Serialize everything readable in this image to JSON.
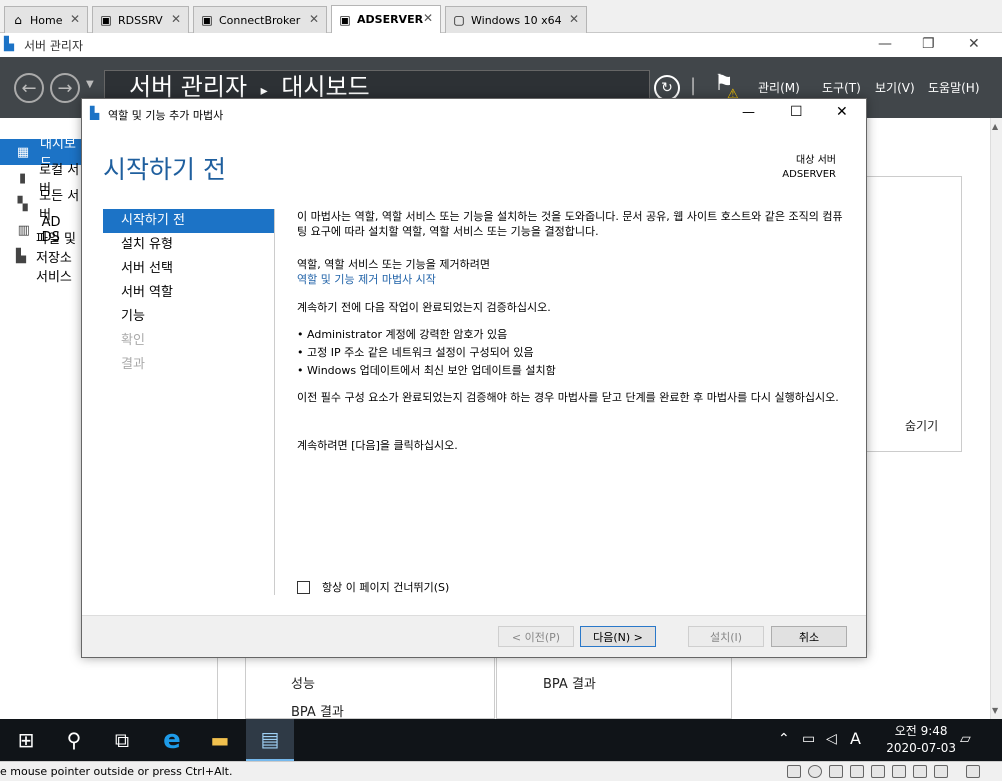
{
  "host_tabs": [
    {
      "label": "Home",
      "icon": "home-icon"
    },
    {
      "label": "RDSSRV",
      "icon": "vm-icon"
    },
    {
      "label": "ConnectBroker",
      "icon": "vm-icon"
    },
    {
      "label": "ADSERVER",
      "icon": "vm-icon"
    },
    {
      "label": "Windows 10 x64",
      "icon": "vm-icon"
    }
  ],
  "server_manager": {
    "window_title": "서버 관리자",
    "breadcrumb": {
      "root": "서버 관리자",
      "separator": "▸",
      "page": "대시보드"
    },
    "menu": [
      "관리(M)",
      "도구(T)",
      "보기(V)",
      "도움말(H)"
    ],
    "sidebar": [
      "대시보드",
      "로컬 서버",
      "모든 서버",
      "AD DS",
      "파일 및 저장소 서비스"
    ],
    "background": {
      "hide_label": "숨기기",
      "tile1": [
        "성능",
        "BPA 결과"
      ],
      "tile2": [
        "BPA 결과"
      ]
    }
  },
  "wizard": {
    "title": "역할 및 기능 추가 마법사",
    "heading": "시작하기 전",
    "dest_label": "대상 서버",
    "dest_server": "ADSERVER",
    "steps": [
      {
        "label": "시작하기 전",
        "state": "active"
      },
      {
        "label": "설치 유형",
        "state": "enabled"
      },
      {
        "label": "서버 선택",
        "state": "enabled"
      },
      {
        "label": "서버 역할",
        "state": "enabled"
      },
      {
        "label": "기능",
        "state": "enabled"
      },
      {
        "label": "확인",
        "state": "disabled"
      },
      {
        "label": "결과",
        "state": "disabled"
      }
    ],
    "intro": "이 마법사는 역할, 역할 서비스 또는 기능을 설치하는 것을 도와줍니다. 문서 공유, 웹 사이트 호스트와 같은 조직의 컴퓨팅 요구에 따라 설치할 역할, 역할 서비스 또는 기능을 결정합니다.",
    "remove_text": "역할, 역할 서비스 또는 기능을 제거하려면",
    "remove_link": "역할 및 기능 제거 마법사 시작",
    "verify_text": "계속하기 전에 다음 작업이 완료되었는지 검증하십시오.",
    "bullets": [
      "Administrator 계정에 강력한 암호가 있음",
      "고정 IP 주소 같은 네트워크 설정이 구성되어 있음",
      "Windows 업데이트에서 최신 보안 업데이트를 설치함"
    ],
    "prereq_text": "이전 필수 구성 요소가 완료되었는지 검증해야 하는 경우 마법사를 닫고 단계를 완료한 후 마법사를 다시 실행하십시오.",
    "continue_text": "계속하려면 [다음]을 클릭하십시오.",
    "skip_checkbox": "항상 이 페이지 건너뛰기(S)",
    "buttons": {
      "prev": "< 이전(P)",
      "next": "다음(N) >",
      "install": "설치(I)",
      "cancel": "취소"
    }
  },
  "taskbar": {
    "time": "오전 9:48",
    "date": "2020-07-03",
    "ime": "A"
  },
  "status_bar": {
    "text": "e mouse pointer outside or press Ctrl+Alt."
  },
  "colors": {
    "accent": "#1c73c6",
    "header_bg": "#41464a",
    "taskbar_bg": "#101418",
    "heading": "#1f5f9e"
  }
}
